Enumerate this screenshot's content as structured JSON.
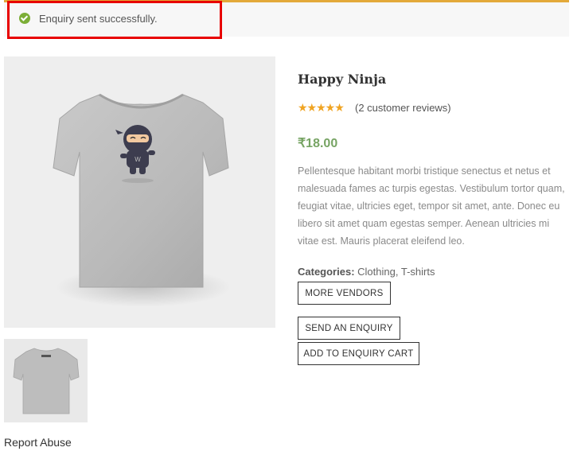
{
  "notice": {
    "message": "Enquiry sent successfully.",
    "icon": "check-circle-icon",
    "accent_color": "#e3a93a",
    "icon_color": "#7cae37",
    "highlight_color": "#e80000"
  },
  "product": {
    "title": "Happy Ninja",
    "rating": 5,
    "rating_max": 5,
    "stars": "★★★★★",
    "reviews_text": "(2 customer reviews)",
    "price": "₹18.00",
    "price_color": "#77a464",
    "description": "Pellentesque habitant morbi tristique senectus et netus et malesuada fames ac turpis egestas. Vestibulum tortor quam, feugiat vitae, ultricies eget, tempor sit amet, ante. Donec eu libero sit amet quam egestas semper. Aenean ultricies mi vitae est. Mauris placerat eleifend leo.",
    "categories_label": "Categories:",
    "categories": [
      "Clothing",
      "T-shirts"
    ],
    "categories_separator": ", "
  },
  "buttons": {
    "more_vendors": "MORE VENDORS",
    "send_enquiry": "SEND AN ENQUIRY",
    "add_to_cart": "ADD TO ENQUIRY CART"
  },
  "footer": {
    "report_abuse": "Report Abuse"
  }
}
